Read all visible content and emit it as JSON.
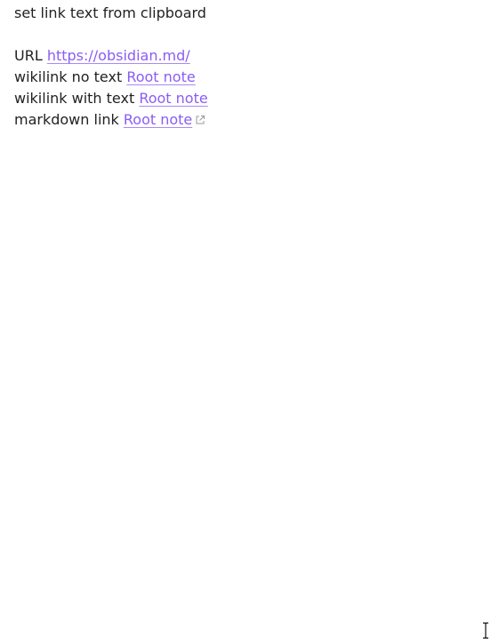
{
  "note": {
    "title_line": "set link text from clipboard",
    "lines": [
      {
        "prefix": "URL ",
        "link_text": "https://obsidian.md/"
      },
      {
        "prefix": "wikilink no text ",
        "link_text": "Root note"
      },
      {
        "prefix": "wikilink with text ",
        "link_text": "Root note"
      },
      {
        "prefix": "markdown link ",
        "link_text": "Root note",
        "external_icon": "external-link-icon"
      }
    ]
  },
  "colors": {
    "text": "#222222",
    "link": "#8a5cf5",
    "background": "#ffffff"
  },
  "icons": {
    "cursor": "text-cursor-icon"
  }
}
